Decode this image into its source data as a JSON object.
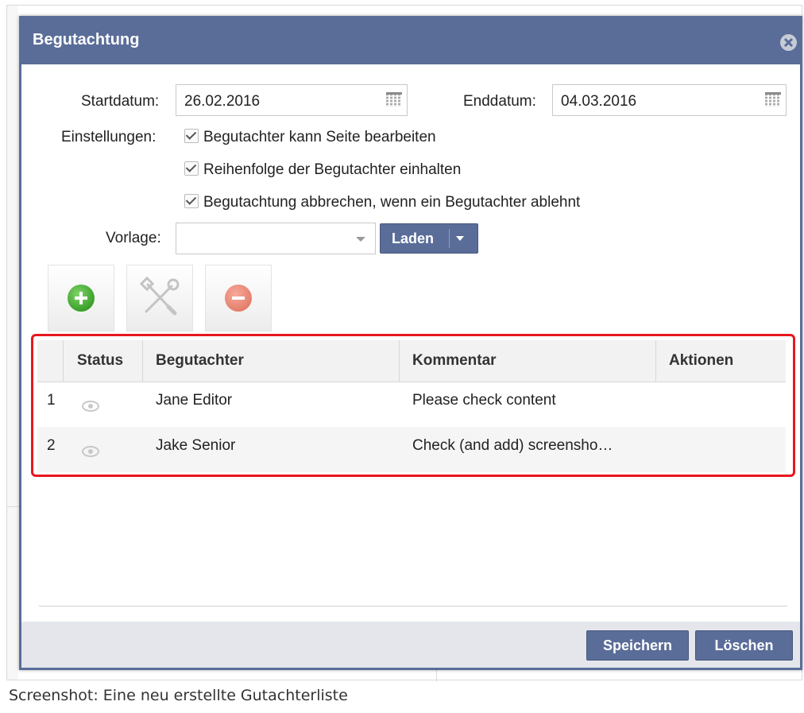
{
  "dialog": {
    "title": "Begutachtung"
  },
  "form": {
    "start_label": "Startdatum:",
    "start_value": "26.02.2016",
    "end_label": "Enddatum:",
    "end_value": "04.03.2016",
    "settings_label": "Einstellungen:",
    "settings": [
      {
        "label": "Begutachter kann Seite bearbeiten",
        "checked": true
      },
      {
        "label": "Reihenfolge der Begutachter einhalten",
        "checked": true
      },
      {
        "label": "Begutachtung abbrechen, wenn ein Begutachter ablehnt",
        "checked": true
      }
    ],
    "template_label": "Vorlage:",
    "template_value": "",
    "load_button": "Laden"
  },
  "toolbar": {
    "icons": [
      "add-icon",
      "settings-icon",
      "remove-icon"
    ]
  },
  "grid": {
    "columns": [
      "Status",
      "Begutachter",
      "Kommentar",
      "Aktionen"
    ],
    "rows": [
      {
        "index": "1",
        "status_icon": "eye-icon",
        "reviewer": "Jane Editor",
        "comment": "Please check content",
        "actions": ""
      },
      {
        "index": "2",
        "status_icon": "eye-icon",
        "reviewer": "Jake Senior",
        "comment": "Check (and add) screensho…",
        "actions": ""
      }
    ]
  },
  "footer": {
    "save_button": "Speichern",
    "delete_button": "Löschen"
  },
  "caption": "Screenshot: Eine neu erstellte Gutachterliste",
  "colors": {
    "titlebar": "#5a6d99",
    "highlight": "#e8161f",
    "add": "#1e8a0e",
    "remove": "#de6c58"
  }
}
